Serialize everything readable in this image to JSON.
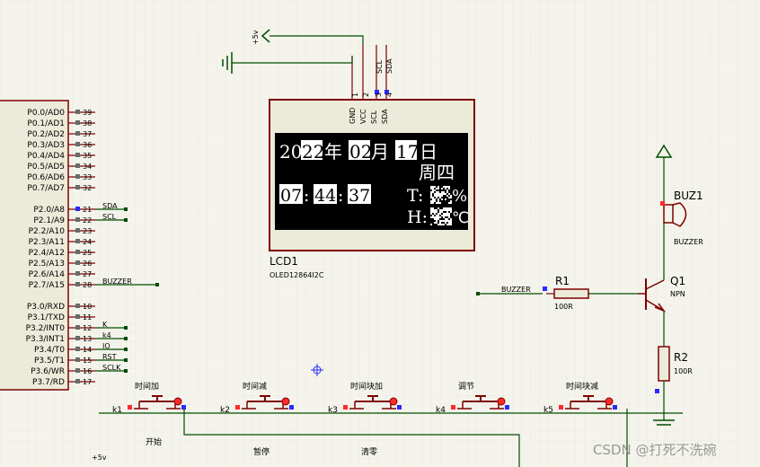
{
  "colors": {
    "background": "#f4f4ec",
    "grid": "#e3e3d8",
    "wire": "#004c00",
    "component": "#7f0000",
    "label": "#000000",
    "pin_blue": "#2a2aff",
    "pin_red": "#ff2a2a",
    "lcd_body": "#ecebd9",
    "lcd_screen": "#000000"
  },
  "mcu": {
    "pins_port0": [
      {
        "label": "P0.0/AD0",
        "num": "39"
      },
      {
        "label": "P0.1/AD1",
        "num": "38"
      },
      {
        "label": "P0.2/AD2",
        "num": "37"
      },
      {
        "label": "P0.3/AD3",
        "num": "36"
      },
      {
        "label": "P0.4/AD4",
        "num": "35"
      },
      {
        "label": "P0.5/AD5",
        "num": "34"
      },
      {
        "label": "P0.6/AD6",
        "num": "33"
      },
      {
        "label": "P0.7/AD7",
        "num": "32"
      }
    ],
    "pins_port2": [
      {
        "label": "P2.0/A8",
        "num": "21",
        "net": "SDA"
      },
      {
        "label": "P2.1/A9",
        "num": "22",
        "net": "SCL"
      },
      {
        "label": "P2.2/A10",
        "num": "23",
        "net": ""
      },
      {
        "label": "P2.3/A11",
        "num": "24",
        "net": ""
      },
      {
        "label": "P2.4/A12",
        "num": "25",
        "net": ""
      },
      {
        "label": "P2.5/A13",
        "num": "26",
        "net": ""
      },
      {
        "label": "P2.6/A14",
        "num": "27",
        "net": ""
      },
      {
        "label": "P2.7/A15",
        "num": "28",
        "net": "BUZZER"
      }
    ],
    "pins_port3": [
      {
        "label": "P3.0/RXD",
        "num": "10",
        "net": ""
      },
      {
        "label": "P3.1/TXD",
        "num": "11",
        "net": ""
      },
      {
        "label": "P3.2/INT0",
        "num": "12",
        "net": "K"
      },
      {
        "label": "P3.3/INT1",
        "num": "13",
        "net": "k4"
      },
      {
        "label": "P3.4/T0",
        "num": "14",
        "net": "IO"
      },
      {
        "label": "P3.5/T1",
        "num": "15",
        "net": "RST"
      },
      {
        "label": "P3.6/WR",
        "num": "16",
        "net": "SCLK"
      },
      {
        "label": "P3.7/RD",
        "num": "17",
        "net": ""
      }
    ]
  },
  "lcd": {
    "ref": "LCD1",
    "part": "OLED12864I2C",
    "pins": [
      "GND",
      "VCC",
      "SCL",
      "SDA"
    ],
    "pin_nums": [
      "1",
      "2",
      "3",
      "4"
    ],
    "top_nets": [
      "SCL",
      "SDA"
    ],
    "screen": {
      "year_prefix": "20",
      "year": "22",
      "year_char": "年",
      "month": "02",
      "month_char": "月",
      "day": "17",
      "day_char": "日",
      "weekday": "周四",
      "hour": "07",
      "minute": "44",
      "second": "37",
      "colon": ":",
      "temp_label": "T:",
      "temp_unit": "%",
      "hum_label": "H:",
      "hum_unit": "℃"
    }
  },
  "power": {
    "vcc_label": "+5v",
    "bottom_vcc_label": "+5v"
  },
  "buzzer": {
    "ref": "BUZ1",
    "part": "BUZZER"
  },
  "r1": {
    "ref": "R1",
    "value": "100R",
    "net": "BUZZER"
  },
  "q1": {
    "ref": "Q1",
    "part": "NPN"
  },
  "r2": {
    "ref": "R2",
    "value": "100R"
  },
  "buttons": [
    {
      "ref": "k1",
      "title": "时间加"
    },
    {
      "ref": "k2",
      "title": "时间减"
    },
    {
      "ref": "k3",
      "title": "时间块加"
    },
    {
      "ref": "k4",
      "title": "调节"
    },
    {
      "ref": "k5",
      "title": "时间块减"
    }
  ],
  "bottom_labels": [
    "开始",
    "暂停",
    "清零"
  ],
  "watermark": "CSDN @打死不洗碗"
}
